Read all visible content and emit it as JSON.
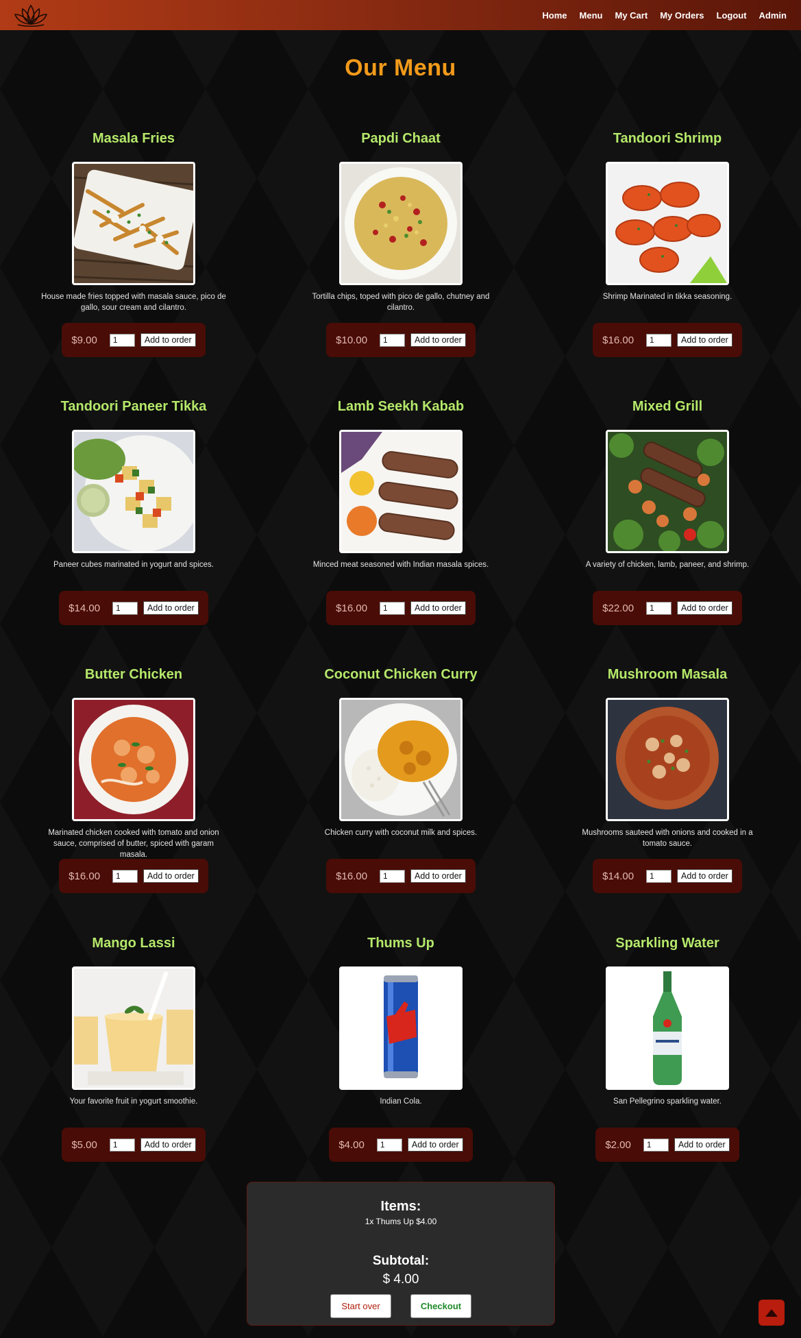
{
  "nav": {
    "links": [
      "Home",
      "Menu",
      "My Cart",
      "My Orders",
      "Logout",
      "Admin"
    ]
  },
  "page": {
    "title": "Our Menu"
  },
  "colors": {
    "title_accent": "#f29a1a",
    "item_title": "#b5e86a",
    "order_box": "#4a0c06",
    "cart_panel": "#2b2b2b",
    "start_over": "#b01c0c",
    "checkout": "#1f8a2a",
    "scroll_top": "#b81d0d"
  },
  "menu_items": [
    {
      "name": "Masala Fries",
      "description": "House made fries topped with masala sauce, pico de gallo, sour cream and cilantro.",
      "price": "$9.00",
      "qty": "1",
      "button": "Add to order",
      "image": "masala-fries-photo"
    },
    {
      "name": "Papdi Chaat",
      "description": "Tortilla chips, toped with pico de gallo, chutney and cilantro.",
      "price": "$10.00",
      "qty": "1",
      "button": "Add to order",
      "image": "papdi-chaat-photo"
    },
    {
      "name": "Tandoori Shrimp",
      "description": "Shrimp Marinated in tikka seasoning.",
      "price": "$16.00",
      "qty": "1",
      "button": "Add to order",
      "image": "tandoori-shrimp-photo"
    },
    {
      "name": "Tandoori Paneer Tikka",
      "description": "Paneer cubes marinated in yogurt and spices.",
      "price": "$14.00",
      "qty": "1",
      "button": "Add to order",
      "image": "paneer-tikka-photo"
    },
    {
      "name": "Lamb Seekh Kabab",
      "description": "Minced meat seasoned with Indian masala spices.",
      "price": "$16.00",
      "qty": "1",
      "button": "Add to order",
      "image": "lamb-kabab-photo"
    },
    {
      "name": "Mixed Grill",
      "description": "A variety of chicken, lamb, paneer, and shrimp.",
      "price": "$22.00",
      "qty": "1",
      "button": "Add to order",
      "image": "mixed-grill-photo"
    },
    {
      "name": "Butter Chicken",
      "description": "Marinated chicken cooked with tomato and onion sauce, comprised of butter, spiced with garam masala.",
      "price": "$16.00",
      "qty": "1",
      "button": "Add to order",
      "image": "butter-chicken-photo"
    },
    {
      "name": "Coconut Chicken Curry",
      "description": "Chicken curry with coconut milk and spices.",
      "price": "$16.00",
      "qty": "1",
      "button": "Add to order",
      "image": "coconut-curry-photo"
    },
    {
      "name": "Mushroom Masala",
      "description": "Mushrooms sauteed with onions and cooked in a tomato sauce.",
      "price": "$14.00",
      "qty": "1",
      "button": "Add to order",
      "image": "mushroom-masala-photo"
    },
    {
      "name": "Mango Lassi",
      "description": "Your favorite fruit in yogurt smoothie.",
      "price": "$5.00",
      "qty": "1",
      "button": "Add to order",
      "image": "mango-lassi-photo"
    },
    {
      "name": "Thums Up",
      "description": "Indian Cola.",
      "price": "$4.00",
      "qty": "1",
      "button": "Add to order",
      "image": "thums-up-can-photo"
    },
    {
      "name": "Sparkling Water",
      "description": "San Pellegrino sparkling water.",
      "price": "$2.00",
      "qty": "1",
      "button": "Add to order",
      "image": "sparkling-water-bottle-photo"
    }
  ],
  "cart": {
    "items_title": "Items:",
    "lines": [
      "1x Thums Up $4.00"
    ],
    "subtotal_title": "Subtotal:",
    "subtotal_value": "$ 4.00",
    "start_over_label": "Start over",
    "checkout_label": "Checkout"
  },
  "scroll_top": {
    "icon": "arrow-up-icon"
  }
}
